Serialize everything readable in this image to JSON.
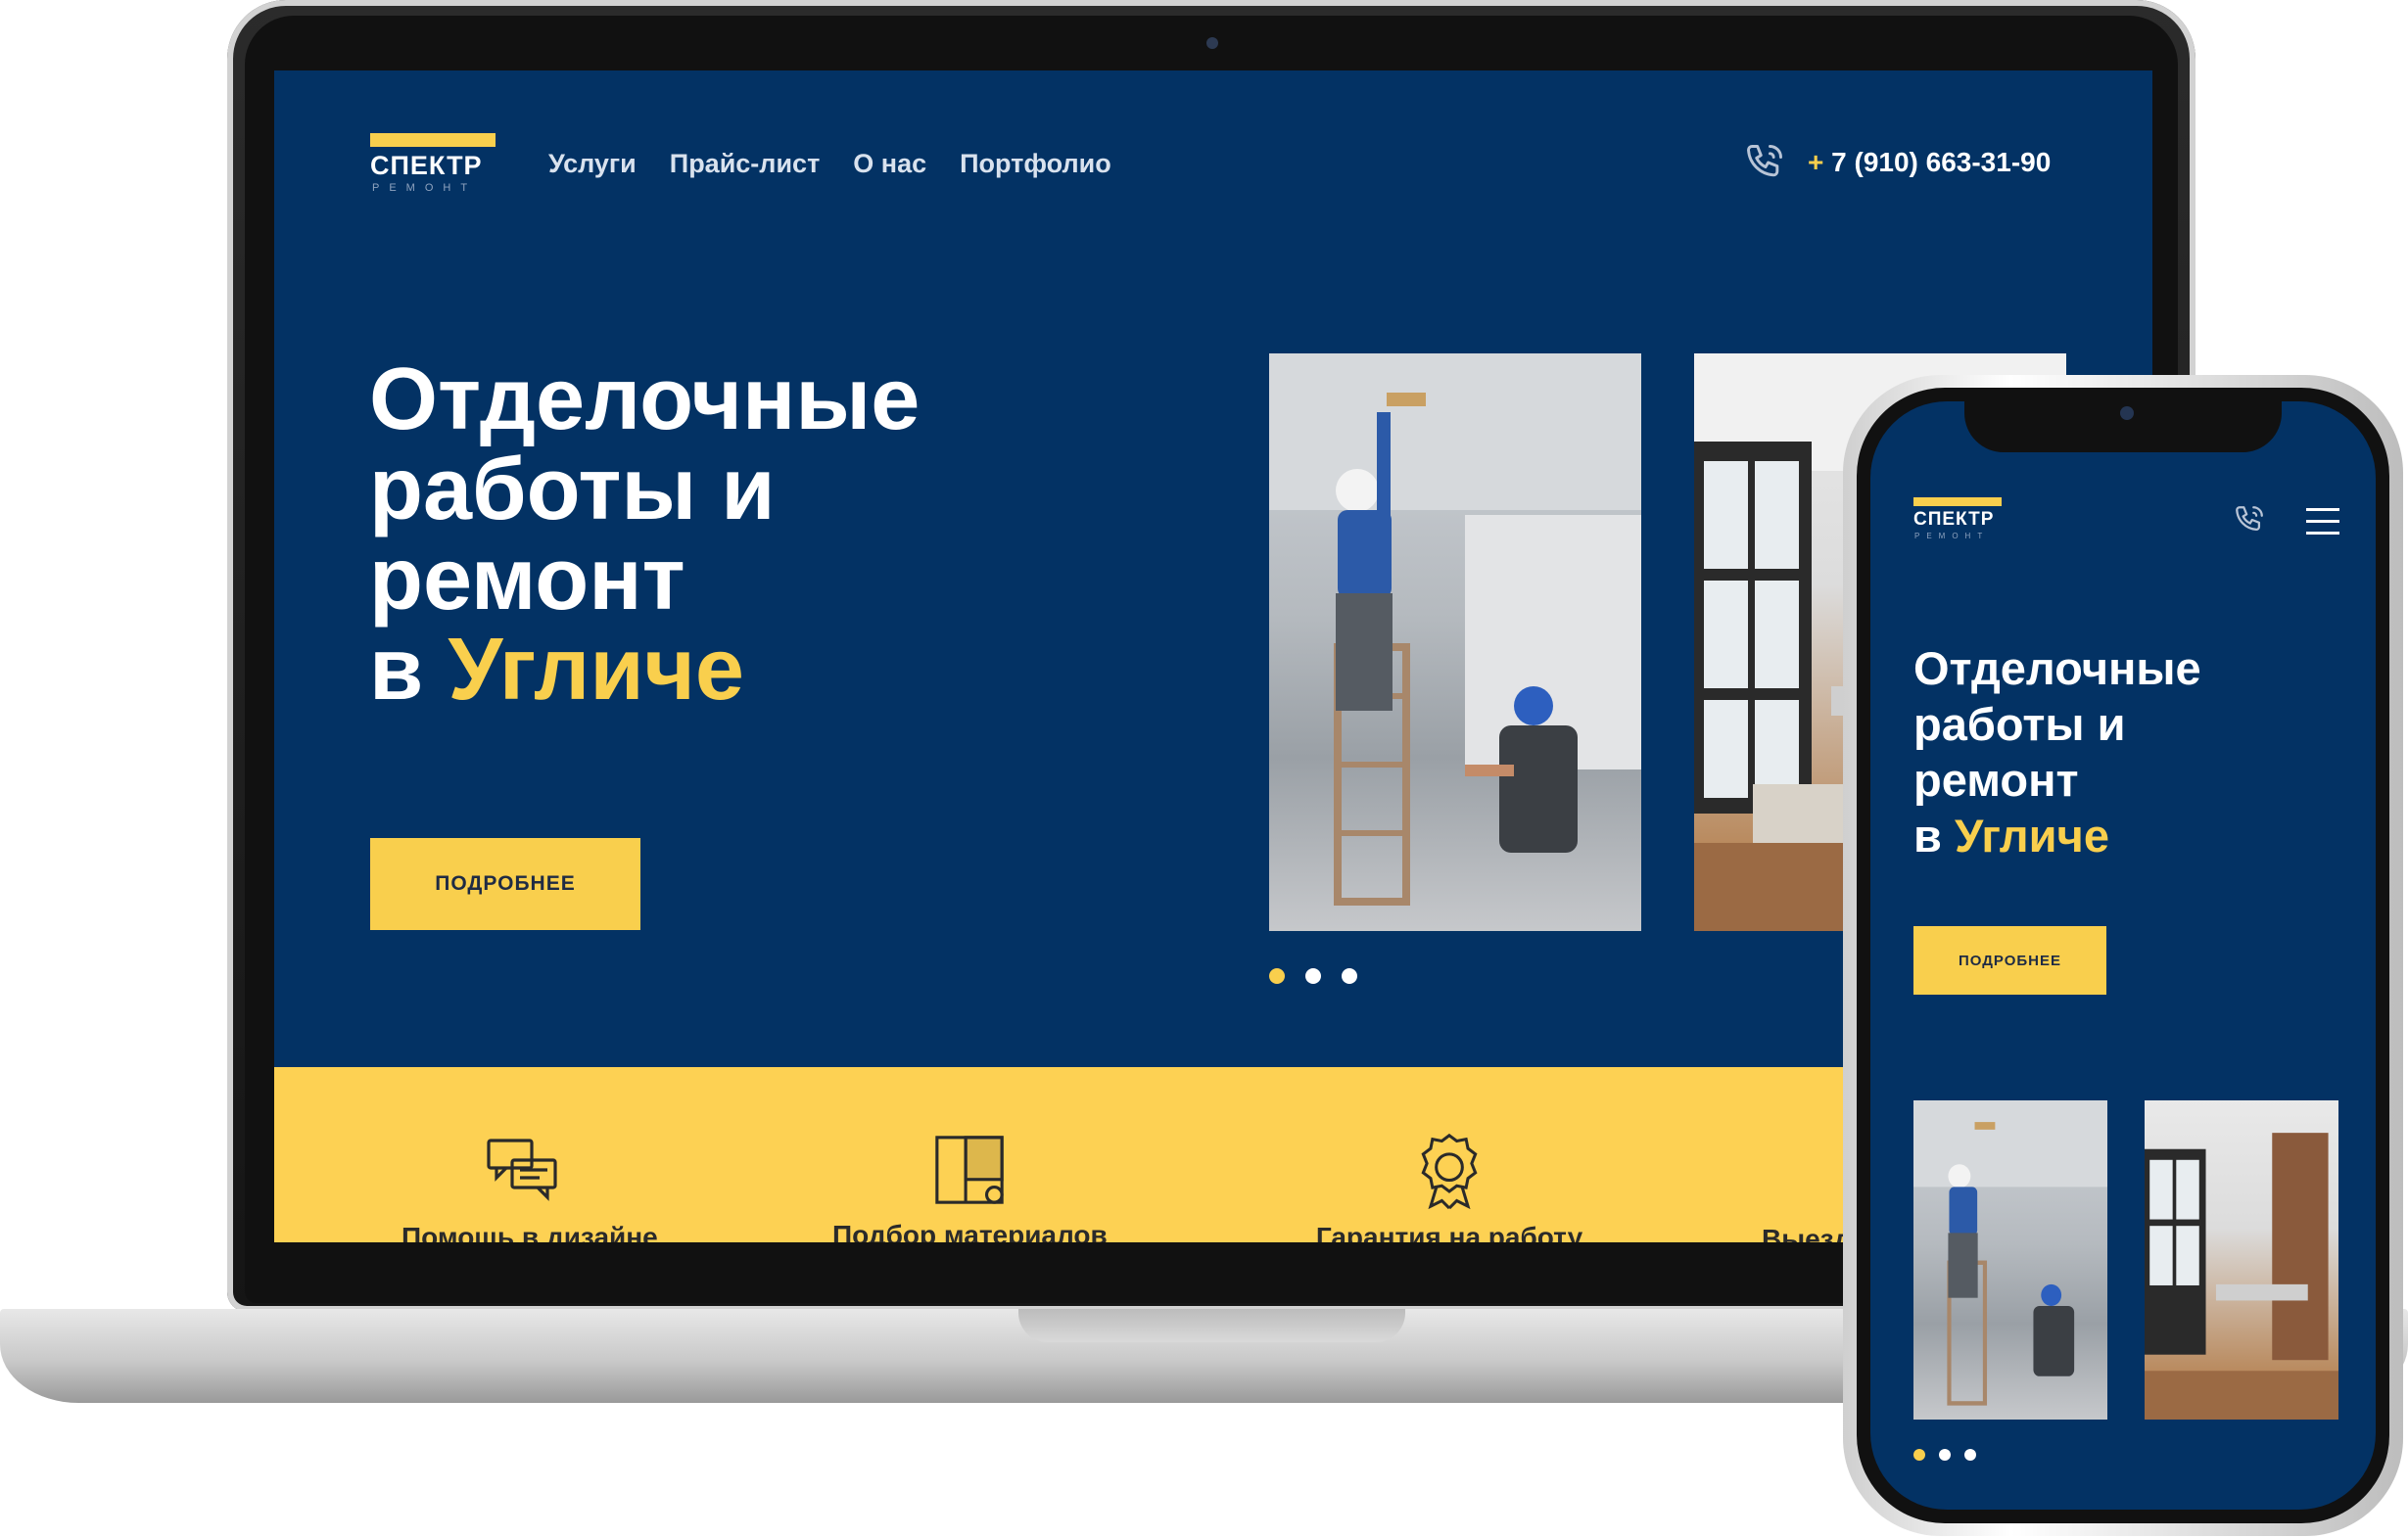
{
  "brand": {
    "name": "СПЕКТР",
    "tagline": "РЕМОНТ"
  },
  "nav": [
    {
      "label": "Услуги"
    },
    {
      "label": "Прайс-лист"
    },
    {
      "label": "О нас"
    },
    {
      "label": "Портфолио"
    }
  ],
  "contact": {
    "phone_prefix": "+",
    "phone_rest": "7 (910) 663-31-90"
  },
  "hero": {
    "line1": "Отделочные",
    "line2": "работы и",
    "line3": "ремонт",
    "line4_prefix": "в ",
    "line4_accent": "Угличе",
    "cta_label": "ПОДРОБНЕЕ"
  },
  "slider": {
    "count": 3,
    "active_index": 0
  },
  "features": [
    {
      "label": "Помощь в дизайне",
      "icon": "chat-bubbles-icon"
    },
    {
      "label": "Подбор материалов",
      "icon": "wallpaper-roll-icon"
    },
    {
      "label": "Гарантия на работу",
      "icon": "guarantee-badge-icon"
    },
    {
      "label": "Выезд на замер",
      "icon": "clipboard-icon"
    }
  ],
  "colors": {
    "navy": "#033264",
    "accent": "#f9cf4d",
    "features_bg": "#fdd153"
  },
  "icons": {
    "phone": "phone-icon",
    "menu": "menu-icon"
  }
}
